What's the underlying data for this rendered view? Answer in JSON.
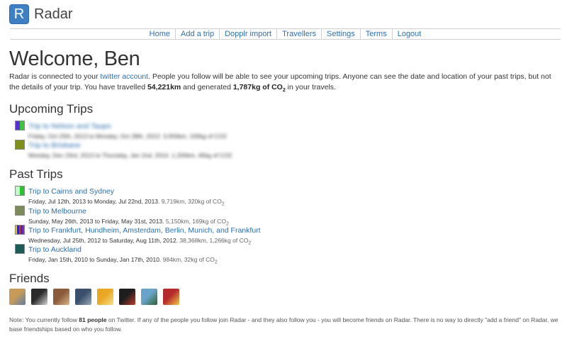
{
  "app": {
    "logo_letter": "R",
    "name": "Radar"
  },
  "nav": [
    "Home",
    "Add a trip",
    "Dopplr import",
    "Travellers",
    "Settings",
    "Terms",
    "Logout"
  ],
  "welcome": "Welcome, Ben",
  "intro": {
    "p1": "Radar is connected to your ",
    "link": "twitter account",
    "p2": ". People you follow will be able to see your upcoming trips. Anyone can see the date and location of your past trips, but not the details of your trip. You have travelled ",
    "distance": "54,221km",
    "p3": " and generated ",
    "co2": "1,787kg of CO",
    "co2_sub": "2",
    "p4": " in your travels."
  },
  "upcoming": {
    "heading": "Upcoming Trips",
    "trips": [
      {
        "title": "Trip to Nelson and Taupo",
        "dates": "Friday, Oct 25th, 2013 to Monday, Oct 28th, 2013. 3,000km, 100kg of CO2",
        "colors": [
          "#5b2fd1",
          "#39c63a"
        ]
      },
      {
        "title": "Trip to Brisbane",
        "dates": "Monday, Dec 23rd, 2013 to Thursday, Jan 2nd, 2014. 1,200km, 45kg of CO2",
        "colors": [
          "#7f8f19"
        ]
      }
    ]
  },
  "past": {
    "heading": "Past Trips",
    "trips": [
      {
        "title": "Trip to Cairns and Sydney",
        "dates": "Friday, Jul 12th, 2013 to Monday, Jul 22nd, 2013.",
        "stats": "9,719km, 320kg of CO",
        "sub": "2",
        "colors": [
          "#c9f2cf",
          "#27c42e"
        ]
      },
      {
        "title": "Trip to Melbourne",
        "dates": "Sunday, May 26th, 2013 to Friday, May 31st, 2013.",
        "stats": "5,150km, 169kg of CO",
        "sub": "2",
        "colors": [
          "#7b8a59"
        ]
      },
      {
        "title": "Trip to Frankfurt, Hundheim, Amsterdam, Berlin, Munich, and Frankfurt",
        "dates": "Wednesday, Jul 25th, 2012 to Saturday, Aug 11th, 2012.",
        "stats": "38,368km, 1,266kg of CO",
        "sub": "2",
        "colors": [
          "#e3c21d",
          "#2d27b8",
          "#c23b2a",
          "#4a2bb0",
          "#8a2bbf"
        ]
      },
      {
        "title": "Trip to Auckland",
        "dates": "Friday, Jan 15th, 2010 to Sunday, Jan 17th, 2010.",
        "stats": "984km, 32kg of CO",
        "sub": "2",
        "colors": [
          "#1b5c56"
        ]
      }
    ]
  },
  "friends": {
    "heading": "Friends",
    "avatars": [
      {
        "name": "friend-avatar-1",
        "colors": [
          "#c89a5a",
          "#5d7fa6"
        ]
      },
      {
        "name": "friend-avatar-2",
        "colors": [
          "#2b2b2b",
          "#d7d7d7"
        ]
      },
      {
        "name": "friend-avatar-3",
        "colors": [
          "#8b5a3a",
          "#d9b48a"
        ]
      },
      {
        "name": "friend-avatar-4",
        "colors": [
          "#3a4f6b",
          "#9aa8b8"
        ]
      },
      {
        "name": "friend-avatar-5",
        "colors": [
          "#e8a825",
          "#f6e08a"
        ]
      },
      {
        "name": "friend-avatar-6",
        "colors": [
          "#1d1d1d",
          "#c23a2a"
        ]
      },
      {
        "name": "friend-avatar-7",
        "colors": [
          "#6aa3c9",
          "#2f5f2f"
        ]
      },
      {
        "name": "friend-avatar-8",
        "colors": [
          "#b52a2a",
          "#f0c84a"
        ]
      }
    ]
  },
  "note": {
    "p1": "Note: You currently follow ",
    "count": "81 people",
    "p2": " on Twitter. If any of the people you follow join Radar - and they also follow you - you will become friends on Radar. There is no way to directly \"add a friend\" on Radar, we base friendships based on who you follow."
  }
}
